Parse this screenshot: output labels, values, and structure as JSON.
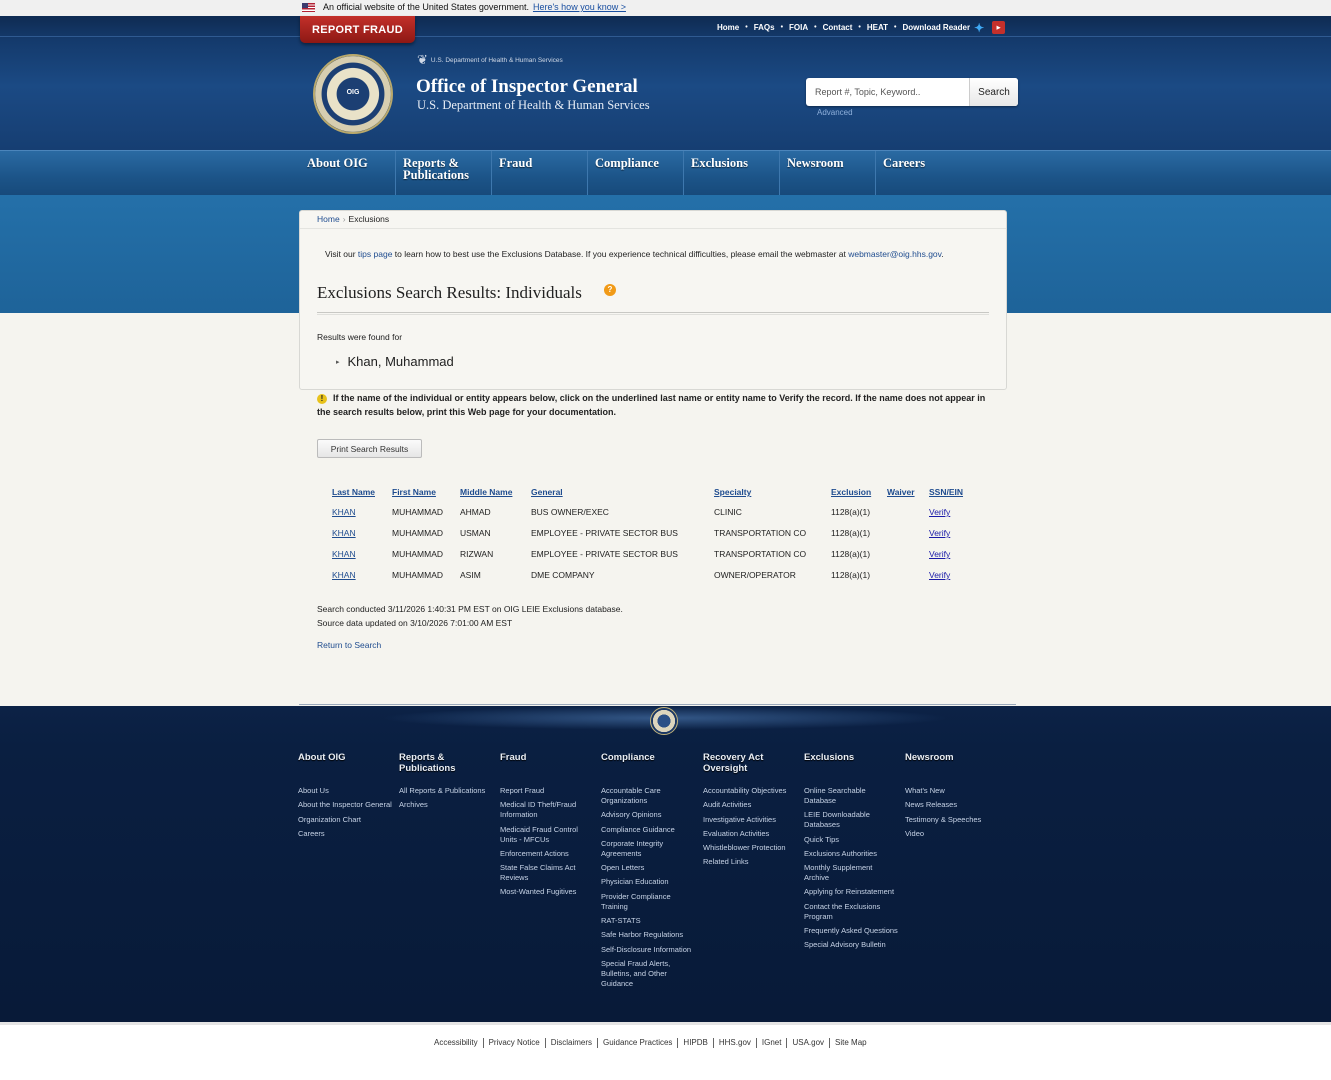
{
  "gov_banner": {
    "text": "An official website of the United States government.",
    "link": "Here's how you know >"
  },
  "header": {
    "report_fraud": "REPORT FRAUD",
    "toplinks": [
      "Home",
      "FAQs",
      "FOIA",
      "Contact",
      "HEAT",
      "Download Reader"
    ],
    "dept_small": "U.S. Department of Health & Human Services",
    "title": "Office of Inspector General",
    "subtitle": "U.S. Department of Health & Human Services",
    "seal_text": "OIG",
    "search": {
      "placeholder": "Report #, Topic, Keyword..",
      "button": "Search",
      "advanced": "Advanced"
    }
  },
  "nav": [
    "About OIG",
    "Reports & Publications",
    "Fraud",
    "Compliance",
    "Exclusions",
    "Newsroom",
    "Careers"
  ],
  "breadcrumb": {
    "home": "Home",
    "current": "Exclusions"
  },
  "main": {
    "tips_prefix": "Visit our ",
    "tips_link": "tips page",
    "tips_middle": " to learn how to best use the Exclusions Database. If you experience technical difficulties, please email the webmaster at ",
    "tips_email": "webmaster@oig.hhs.gov",
    "tips_suffix": ".",
    "title": "Exclusions Search Results: Individuals",
    "results_for": "Results were found for",
    "searched_name": "Khan, Muhammad",
    "notice": "If the name of the individual or entity appears below, click on the underlined last name or entity name to Verify the record. If the name does not appear in the search results below, print this Web page for your documentation.",
    "print_button": "Print Search Results",
    "table": {
      "headers": [
        "Last Name",
        "First Name",
        "Middle Name",
        "General",
        "Specialty",
        "Exclusion",
        "Waiver",
        "SSN/EIN"
      ],
      "rows": [
        [
          "KHAN",
          "MUHAMMAD",
          "AHMAD",
          "BUS OWNER/EXEC",
          "CLINIC",
          "1128(a)(1)",
          "",
          "Verify"
        ],
        [
          "KHAN",
          "MUHAMMAD",
          "USMAN",
          "EMPLOYEE - PRIVATE SECTOR BUS",
          "TRANSPORTATION CO",
          "1128(a)(1)",
          "",
          "Verify"
        ],
        [
          "KHAN",
          "MUHAMMAD",
          "RIZWAN",
          "EMPLOYEE - PRIVATE SECTOR BUS",
          "TRANSPORTATION CO",
          "1128(a)(1)",
          "",
          "Verify"
        ],
        [
          "KHAN",
          "MUHAMMAD",
          "ASIM",
          "DME COMPANY",
          "OWNER/OPERATOR",
          "1128(a)(1)",
          "",
          "Verify"
        ]
      ]
    },
    "search_conducted": "Search conducted 3/11/2026 1:40:31 PM EST on OIG LEIE Exclusions database.",
    "source_updated": "Source data updated on 3/10/2026 7:01:00 AM EST",
    "return_link": "Return to Search"
  },
  "footer": {
    "columns": [
      {
        "heading": "About OIG",
        "links": [
          "About Us",
          "About the Inspector General",
          "Organization Chart",
          "Careers"
        ]
      },
      {
        "heading": "Reports & Publications",
        "links": [
          "All Reports & Publications",
          "Archives"
        ]
      },
      {
        "heading": "Fraud",
        "links": [
          "Report Fraud",
          "Medical ID Theft/Fraud Information",
          "Medicaid Fraud Control Units - MFCUs",
          "Enforcement Actions",
          "State False Claims Act Reviews",
          "Most-Wanted Fugitives"
        ]
      },
      {
        "heading": "Compliance",
        "links": [
          "Accountable Care Organizations",
          "Advisory Opinions",
          "Compliance Guidance",
          "Corporate Integrity Agreements",
          "Open Letters",
          "Physician Education",
          "Provider Compliance Training",
          "RAT-STATS",
          "Safe Harbor Regulations",
          "Self-Disclosure Information",
          "Special Fraud Alerts, Bulletins, and Other Guidance"
        ]
      },
      {
        "heading": "Recovery Act Oversight",
        "links": [
          "Accountability Objectives",
          "Audit Activities",
          "Investigative Activities",
          "Evaluation Activities",
          "Whistleblower Protection",
          "Related Links"
        ]
      },
      {
        "heading": "Exclusions",
        "links": [
          "Online Searchable Database",
          "LEIE Downloadable Databases",
          "Quick Tips",
          "Exclusions Authorities",
          "Monthly Supplement Archive",
          "Applying for Reinstatement",
          "Contact the Exclusions Program",
          "Frequently Asked Questions",
          "Special Advisory Bulletin"
        ]
      },
      {
        "heading": "Newsroom",
        "links": [
          "What's New",
          "News Releases",
          "Testimony & Speeches",
          "Video"
        ]
      }
    ],
    "bottom_links": [
      "Accessibility",
      "Privacy Notice",
      "Disclaimers",
      "Guidance Practices",
      "HIPDB",
      "HHS.gov",
      "IGnet",
      "USA.gov",
      "Site Map"
    ]
  }
}
